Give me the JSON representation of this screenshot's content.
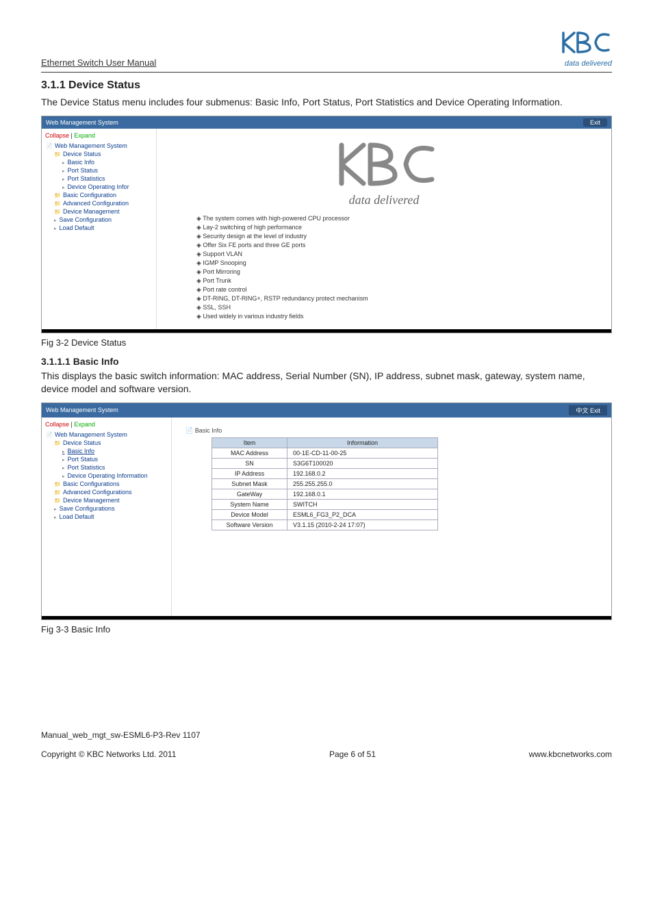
{
  "header": {
    "manual_title": "Ethernet Switch User Manual",
    "brand_tagline": "data delivered"
  },
  "section": {
    "number_title": "3.1.1 Device Status",
    "intro": "The Device Status menu includes four submenus: Basic Info, Port Status, Port Statistics and Device Operating Information."
  },
  "screenshot1": {
    "titlebar": "Web Management System",
    "exit": "Exit",
    "collapse": "Collapse",
    "expand": "Expand",
    "tree": {
      "root": "Web Management System",
      "device_status": "Device Status",
      "basic_info": "Basic Info",
      "port_status": "Port Status",
      "port_statistics": "Port Statistics",
      "device_oper": "Device Operating Infor",
      "basic_config": "Basic Configuration",
      "adv_config": "Advanced Configuration",
      "device_mgmt": "Device Management",
      "save_config": "Save Configuration",
      "load_default": "Load Default"
    },
    "welcome_tagline": "data delivered",
    "features": [
      "The system comes with high-powered CPU processor",
      "Lay-2 switching of high performance",
      "Security design at the level of industry",
      "Offer Six FE ports and three GE ports",
      "Support VLAN",
      "IGMP Snooping",
      "Port Mirroring",
      "Port Trunk",
      "Port rate control",
      "DT-RING, DT-RING+, RSTP redundancy protect mechanism",
      "SSL, SSH",
      "Used widely in various industry fields"
    ]
  },
  "caption1": "Fig 3-2 Device Status",
  "subsection": {
    "number_title": "3.1.1.1 Basic Info",
    "intro": "This displays the basic switch information: MAC address, Serial Number (SN), IP address, subnet mask, gateway, system name, device model and software version."
  },
  "screenshot2": {
    "titlebar": "Web Management System",
    "lang_exit": "中文 Exit",
    "collapse": "Collapse",
    "expand": "Expand",
    "tree": {
      "root": "Web Management System",
      "device_status": "Device Status",
      "basic_info": "Basic Info",
      "port_status": "Port Status",
      "port_statistics": "Port Statistics",
      "device_oper": "Device Operating Information",
      "basic_config": "Basic Configurations",
      "adv_config": "Advanced Configurations",
      "device_mgmt": "Device Management",
      "save_config": "Save Configurations",
      "load_default": "Load Default"
    },
    "crumb": "Basic Info",
    "table": {
      "h1": "Item",
      "h2": "Information",
      "rows": [
        {
          "k": "MAC Address",
          "v": "00-1E-CD-11-00-25"
        },
        {
          "k": "SN",
          "v": "S3G6T100020"
        },
        {
          "k": "IP Address",
          "v": "192.168.0.2"
        },
        {
          "k": "Subnet Mask",
          "v": "255.255.255.0"
        },
        {
          "k": "GateWay",
          "v": "192.168.0.1"
        },
        {
          "k": "System Name",
          "v": "SWITCH"
        },
        {
          "k": "Device Model",
          "v": "ESML6_FG3_P2_DCA"
        },
        {
          "k": "Software Version",
          "v": "V3.1.15 (2010-2-24 17:07)"
        }
      ]
    }
  },
  "caption2": "Fig 3-3 Basic Info",
  "footer": {
    "manual_code": "Manual_web_mgt_sw-ESML6-P3-Rev 1107",
    "copyright": "Copyright © KBC Networks Ltd. 2011",
    "page": "Page 6 of 51",
    "url": "www.kbcnetworks.com"
  }
}
